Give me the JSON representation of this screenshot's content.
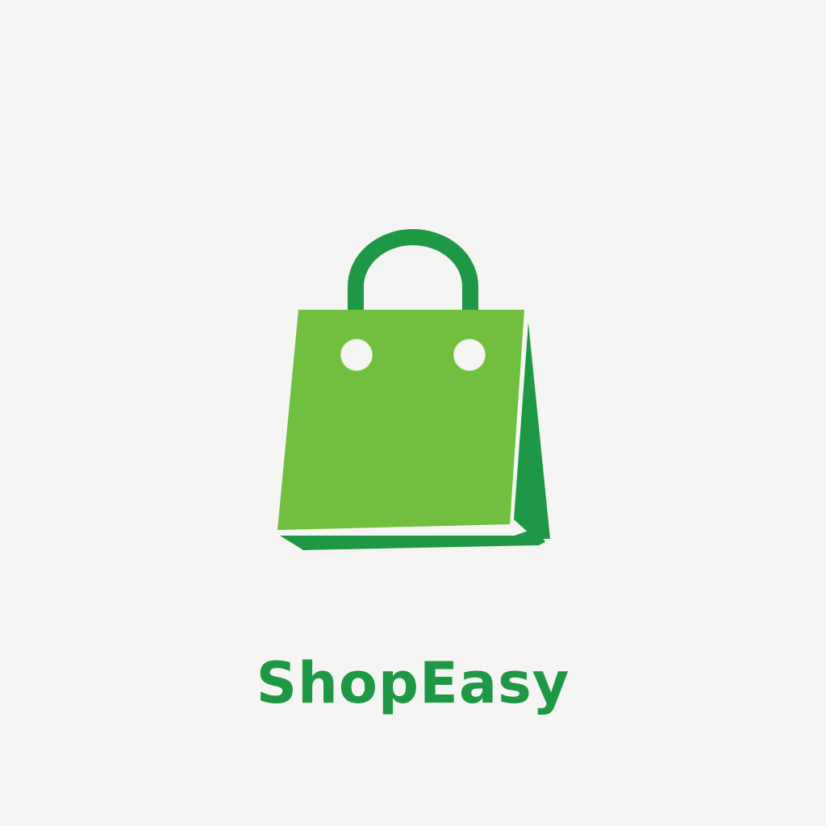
{
  "brand": {
    "name": "ShopEasy",
    "icon": "shopping-bag-icon",
    "colors": {
      "text": "#1f9845",
      "bag_front": "#70bf3f",
      "bag_dark": "#1f9845",
      "background": "#f5f5f3"
    }
  }
}
